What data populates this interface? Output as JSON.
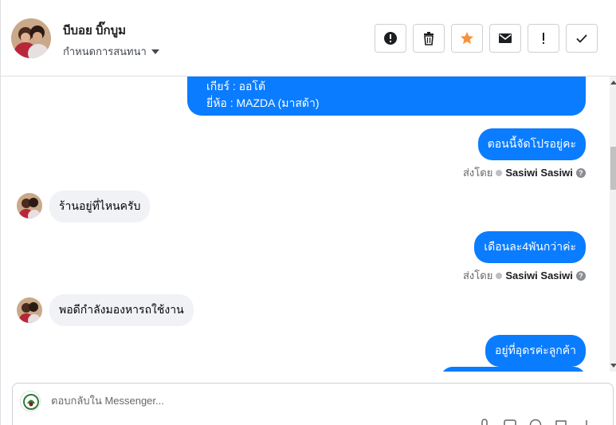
{
  "header": {
    "contact_name": "บีบอย บิ๊กบูม",
    "conversation_settings_label": "กำหนดการสนทนา",
    "actions": [
      {
        "icon": "alert-circle-icon",
        "label": "spam"
      },
      {
        "icon": "trash-icon",
        "label": "delete"
      },
      {
        "icon": "star-icon",
        "label": "star"
      },
      {
        "icon": "envelope-icon",
        "label": "mark-unread"
      },
      {
        "icon": "exclamation-icon",
        "label": "follow-up"
      },
      {
        "icon": "check-icon",
        "label": "done"
      }
    ]
  },
  "colors": {
    "accent": "#0a7cff",
    "star": "#f7923b",
    "incoming_bubble": "#f0f2f5"
  },
  "messages": {
    "first_bubble_line1": "เกียร์ : ออโต้",
    "first_bubble_line2": "ยี่ห้อ : MAZDA (มาสด้า)",
    "out_1": "ตอนนี้จัดโปรอยู่คะ",
    "sent_by_prefix": "ส่งโดย",
    "sender_name": "Sasiwi Sasiwi",
    "in_1": "ร้านอยู่ที่ไหนครับ",
    "out_2": "เดือนละ4พันกว่าค่ะ",
    "in_2": "พอดีกำลังมองหารถใช้งาน",
    "out_3": "อยู่ที่อุดรค่ะลูกค้า"
  },
  "composer": {
    "placeholder": "ตอบกลับใน Messenger..."
  }
}
